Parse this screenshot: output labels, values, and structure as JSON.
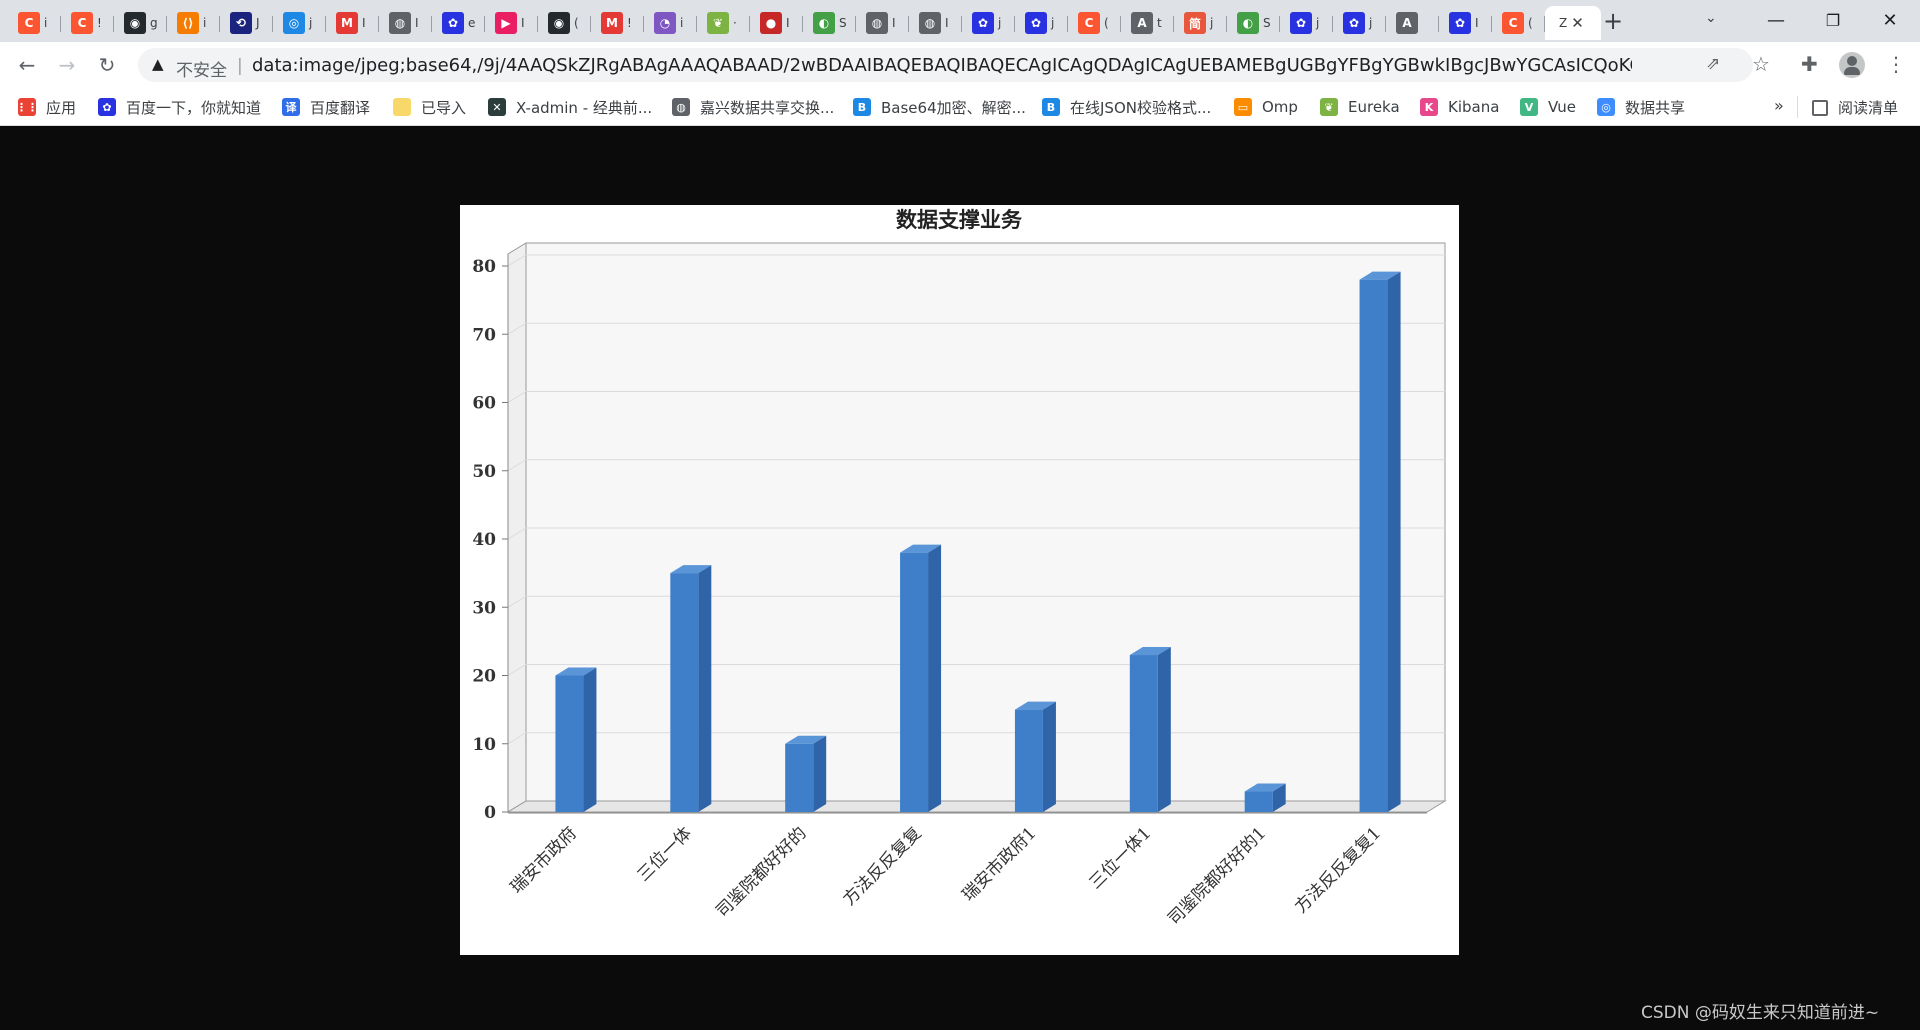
{
  "browser": {
    "tabs": [
      {
        "icon": "csdn-icon",
        "letter": "C",
        "color": "#fc5531",
        "title": "i"
      },
      {
        "icon": "csdn-icon",
        "letter": "C",
        "color": "#fc5531",
        "title": "!"
      },
      {
        "icon": "github-icon",
        "letter": "◉",
        "color": "#24292e",
        "title": "g"
      },
      {
        "icon": "code-icon",
        "letter": "⟨⟩",
        "color": "#f57c00",
        "title": "i"
      },
      {
        "icon": "link-icon",
        "letter": "⟲",
        "color": "#1a237e",
        "title": "J"
      },
      {
        "icon": "globe-blue-icon",
        "letter": "◎",
        "color": "#1e88e5",
        "title": "j"
      },
      {
        "icon": "mail-icon",
        "letter": "M",
        "color": "#e53935",
        "title": "I"
      },
      {
        "icon": "globe-icon",
        "letter": "◍",
        "color": "#5f6368",
        "title": "I"
      },
      {
        "icon": "baidu-icon",
        "letter": "✿",
        "color": "#2932e1",
        "title": "e"
      },
      {
        "icon": "play-icon",
        "letter": "▶",
        "color": "#e91e63",
        "title": "I"
      },
      {
        "icon": "github-icon",
        "letter": "◉",
        "color": "#24292e",
        "title": "("
      },
      {
        "icon": "mail-icon",
        "letter": "M",
        "color": "#e53935",
        "title": "!"
      },
      {
        "icon": "circle-purple-icon",
        "letter": "◔",
        "color": "#7e57c2",
        "title": "i"
      },
      {
        "icon": "leaf-icon",
        "letter": "❦",
        "color": "#7cb342",
        "title": "·"
      },
      {
        "icon": "record-icon",
        "letter": "●",
        "color": "#c62828",
        "title": "I"
      },
      {
        "icon": "eureka-icon",
        "letter": "◐",
        "color": "#43a047",
        "title": "S"
      },
      {
        "icon": "globe-icon",
        "letter": "◍",
        "color": "#5f6368",
        "title": "I"
      },
      {
        "icon": "globe-icon",
        "letter": "◍",
        "color": "#5f6368",
        "title": "I"
      },
      {
        "icon": "baidu-icon",
        "letter": "✿",
        "color": "#2932e1",
        "title": "j"
      },
      {
        "icon": "baidu-icon",
        "letter": "✿",
        "color": "#2932e1",
        "title": "j"
      },
      {
        "icon": "csdn-icon",
        "letter": "C",
        "color": "#fc5531",
        "title": "("
      },
      {
        "icon": "translate-icon",
        "letter": "A",
        "color": "#5f6368",
        "title": "t"
      },
      {
        "icon": "jianshu-icon",
        "letter": "简",
        "color": "#e8573c",
        "title": "j"
      },
      {
        "icon": "eureka-icon",
        "letter": "◐",
        "color": "#43a047",
        "title": "S"
      },
      {
        "icon": "baidu-icon",
        "letter": "✿",
        "color": "#2932e1",
        "title": "j"
      },
      {
        "icon": "baidu-icon",
        "letter": "✿",
        "color": "#2932e1",
        "title": "j"
      },
      {
        "icon": "translate-icon",
        "letter": "A",
        "color": "#5f6368",
        "title": ""
      },
      {
        "icon": "baidu-icon",
        "letter": "✿",
        "color": "#2932e1",
        "title": "I"
      },
      {
        "icon": "csdn-icon",
        "letter": "C",
        "color": "#fc5531",
        "title": "("
      }
    ],
    "active_tab": {
      "title": "Z",
      "close": "✕"
    },
    "new_tab": "+",
    "tab_search": "⌄",
    "window": {
      "minimize": "—",
      "restore": "❐",
      "close": "✕"
    },
    "nav": {
      "back": "←",
      "forward": "→",
      "reload": "↻"
    },
    "omnibox": {
      "warning_icon": "▲",
      "insecure_label": "不安全",
      "separator": "|",
      "url": "data:image/jpeg;base64,/9j/4AAQSkZJRgABAgAAAQABAAD/2wBDAAIBAQEBAQIBAQECAgICAgQDAgICAgUEBAMEBgUGBgYFBgYGBwkIBgcJBwYGCAsICQoKCgoKBggLDAs..."
    },
    "toolbar_icons": {
      "share": "⇗",
      "star": "☆",
      "extensions": "✚",
      "menu": "⋮"
    },
    "bookmarks": [
      {
        "label": "应用",
        "icon": "apps-grid-icon",
        "glyph": "⋮⋮",
        "color": "#ea4335"
      },
      {
        "label": "百度一下，你就知道",
        "icon": "baidu-icon",
        "glyph": "✿",
        "color": "#2932e1"
      },
      {
        "label": "百度翻译",
        "icon": "translate-icon",
        "glyph": "译",
        "color": "#2f6ee8"
      },
      {
        "label": "已导入",
        "icon": "folder-icon",
        "glyph": "",
        "color": "#f9d86a"
      },
      {
        "label": "X-admin - 经典前...",
        "icon": "xadmin-icon",
        "glyph": "✕",
        "color": "#2b3e3c"
      },
      {
        "label": "嘉兴数据共享交换...",
        "icon": "globe-icon",
        "glyph": "◍",
        "color": "#5f6368"
      },
      {
        "label": "Base64加密、解密...",
        "icon": "b-icon",
        "glyph": "B",
        "color": "#1e88e5"
      },
      {
        "label": "在线JSON校验格式...",
        "icon": "b-icon",
        "glyph": "B",
        "color": "#1e88e5"
      },
      {
        "label": "Omp",
        "icon": "monitor-icon",
        "glyph": "▭",
        "color": "#fb8c00"
      },
      {
        "label": "Eureka",
        "icon": "leaf-icon",
        "glyph": "❦",
        "color": "#7cb342"
      },
      {
        "label": "Kibana",
        "icon": "kibana-icon",
        "glyph": "K",
        "color": "#e8488b"
      },
      {
        "label": "Vue",
        "icon": "vue-icon",
        "glyph": "V",
        "color": "#41b883"
      },
      {
        "label": "数据共享",
        "icon": "share-circle-icon",
        "glyph": "◎",
        "color": "#3f8cff"
      }
    ],
    "bookmarks_more": "»",
    "reading_list": "阅读清单"
  },
  "chart_data": {
    "type": "bar",
    "style": "3d",
    "title": "数据支撑业务",
    "categories": [
      "瑞安市政府",
      "三位一体",
      "司鉴院都好好的",
      "方法反反复复",
      "瑞安市政府1",
      "三位一体1",
      "司鉴院都好好的1",
      "方法反反复复1"
    ],
    "values": [
      20,
      35,
      10,
      38,
      15,
      23,
      3,
      78
    ],
    "ylim": [
      0,
      80
    ],
    "yticks": [
      0,
      10,
      20,
      30,
      40,
      50,
      60,
      70,
      80
    ],
    "grid": true,
    "bar_color": "#3f7fca",
    "bar_side_color": "#2f64a8",
    "bar_top_color": "#5a95d8",
    "xlabel": "",
    "ylabel": ""
  },
  "watermark": "CSDN @码奴生来只知道前进~"
}
